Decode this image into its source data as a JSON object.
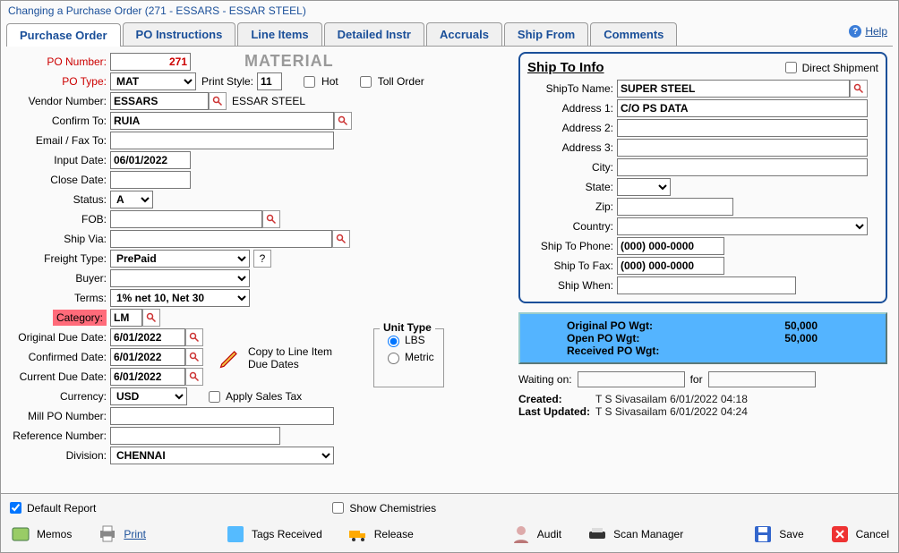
{
  "window_title": "Changing a Purchase Order  (271 - ESSARS -  ESSAR STEEL)",
  "tabs": {
    "po": "Purchase Order",
    "instr": "PO Instructions",
    "lines": "Line Items",
    "detailed": "Detailed Instr",
    "accruals": "Accruals",
    "shipfrom": "Ship From",
    "comments": "Comments"
  },
  "help": "Help",
  "labels": {
    "po_number": "PO Number:",
    "material": "MATERIAL",
    "po_type": "PO Type:",
    "print_style": "Print Style:",
    "hot": "Hot",
    "toll": "Toll Order",
    "vendor_number": "Vendor Number:",
    "confirm_to": "Confirm To:",
    "email_fax": "Email / Fax To:",
    "input_date": "Input Date:",
    "close_date": "Close Date:",
    "status": "Status:",
    "fob": "FOB:",
    "ship_via": "Ship Via:",
    "freight_type": "Freight Type:",
    "buyer": "Buyer:",
    "terms": "Terms:",
    "category": "Category:",
    "orig_due": "Original Due Date:",
    "conf_date": "Confirmed Date:",
    "curr_due": "Current Due Date:",
    "currency": "Currency:",
    "apply_tax": "Apply Sales Tax",
    "mill_po": "Mill PO Number:",
    "ref_num": "Reference Number:",
    "division": "Division:",
    "unit_type": "Unit Type",
    "lbs": "LBS",
    "metric": "Metric",
    "copy_line": "Copy to Line Item Due Dates",
    "qmark": "?"
  },
  "values": {
    "po_number": "271",
    "po_type": "MAT",
    "print_style": "11",
    "vendor_number": "ESSARS",
    "vendor_name": "ESSAR STEEL",
    "confirm_to": "RUIA",
    "email_fax": "",
    "input_date": "06/01/2022",
    "close_date": "",
    "status": "A",
    "fob": "",
    "ship_via": "",
    "freight_type": "PrePaid",
    "buyer": "",
    "terms": "1% net 10, Net 30",
    "category": "LM",
    "orig_due": "6/01/2022",
    "conf_date": "6/01/2022",
    "curr_due": "6/01/2022",
    "currency": "USD",
    "mill_po": "",
    "ref_num": "",
    "division": "CHENNAI"
  },
  "shipto": {
    "header": "Ship To Info",
    "direct": "Direct Shipment",
    "name_lbl": "ShipTo Name:",
    "addr1_lbl": "Address 1:",
    "addr2_lbl": "Address 2:",
    "addr3_lbl": "Address 3:",
    "city_lbl": "City:",
    "state_lbl": "State:",
    "zip_lbl": "Zip:",
    "country_lbl": "Country:",
    "phone_lbl": "Ship To Phone:",
    "fax_lbl": "Ship To Fax:",
    "when_lbl": "Ship When:",
    "name": "SUPER STEEL",
    "addr1": "C/O PS DATA",
    "addr2": "",
    "addr3": "",
    "city": "",
    "state": "",
    "zip": "",
    "country": "",
    "phone": "(000) 000-0000",
    "fax": "(000) 000-0000",
    "when": ""
  },
  "weights": {
    "orig_lbl": "Original PO Wgt:",
    "open_lbl": "Open PO Wgt:",
    "recv_lbl": "Received PO Wgt:",
    "orig": "50,000",
    "open": "50,000",
    "recv": ""
  },
  "waiting": {
    "waiting_lbl": "Waiting on:",
    "for_lbl": "for",
    "waiting": "",
    "for": ""
  },
  "meta": {
    "created_lbl": "Created:",
    "updated_lbl": "Last Updated:",
    "created": "T S Sivasailam 6/01/2022 04:18",
    "updated": "T S Sivasailam 6/01/2022 04:24"
  },
  "bottom": {
    "default_report": "Default Report",
    "show_chem": "Show Chemistries",
    "memos": "Memos",
    "print": "Print",
    "tags": "Tags Received",
    "release": "Release",
    "audit": "Audit",
    "scan": "Scan Manager",
    "save": "Save",
    "cancel": "Cancel"
  }
}
